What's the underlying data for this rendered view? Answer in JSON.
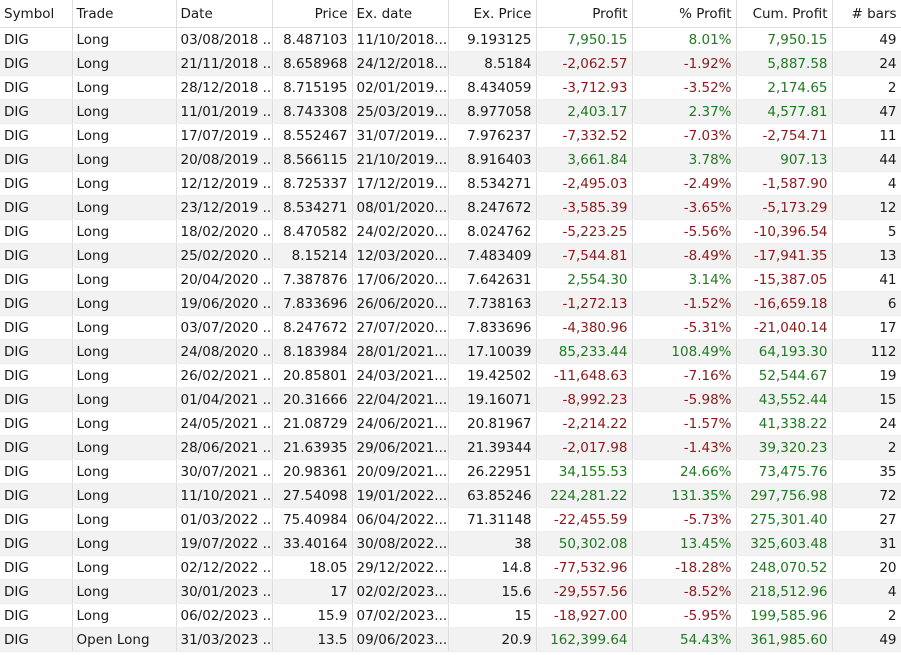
{
  "columns": [
    "Symbol",
    "Trade",
    "Date",
    "Price",
    "Ex. date",
    "Ex. Price",
    "Profit",
    "% Profit",
    "Cum. Profit",
    "# bars"
  ],
  "colors": {
    "positive": "#1f7a1f",
    "negative": "#8b1a1a",
    "stripe": "#f2f2f2"
  },
  "rows": [
    [
      "DIG",
      "Long",
      "03/08/2018 ...",
      "8.487103",
      "11/10/2018...",
      "9.193125",
      "7,950.15",
      "8.01%",
      "7,950.15",
      "49"
    ],
    [
      "DIG",
      "Long",
      "21/11/2018 ...",
      "8.658968",
      "24/12/2018...",
      "8.5184",
      "-2,062.57",
      "-1.92%",
      "5,887.58",
      "24"
    ],
    [
      "DIG",
      "Long",
      "28/12/2018 ...",
      "8.715195",
      "02/01/2019...",
      "8.434059",
      "-3,712.93",
      "-3.52%",
      "2,174.65",
      "2"
    ],
    [
      "DIG",
      "Long",
      "11/01/2019 ...",
      "8.743308",
      "25/03/2019...",
      "8.977058",
      "2,403.17",
      "2.37%",
      "4,577.81",
      "47"
    ],
    [
      "DIG",
      "Long",
      "17/07/2019 ...",
      "8.552467",
      "31/07/2019...",
      "7.976237",
      "-7,332.52",
      "-7.03%",
      "-2,754.71",
      "11"
    ],
    [
      "DIG",
      "Long",
      "20/08/2019 ...",
      "8.566115",
      "21/10/2019...",
      "8.916403",
      "3,661.84",
      "3.78%",
      "907.13",
      "44"
    ],
    [
      "DIG",
      "Long",
      "12/12/2019 ...",
      "8.725337",
      "17/12/2019...",
      "8.534271",
      "-2,495.03",
      "-2.49%",
      "-1,587.90",
      "4"
    ],
    [
      "DIG",
      "Long",
      "23/12/2019 ...",
      "8.534271",
      "08/01/2020...",
      "8.247672",
      "-3,585.39",
      "-3.65%",
      "-5,173.29",
      "12"
    ],
    [
      "DIG",
      "Long",
      "18/02/2020 ...",
      "8.470582",
      "24/02/2020...",
      "8.024762",
      "-5,223.25",
      "-5.56%",
      "-10,396.54",
      "5"
    ],
    [
      "DIG",
      "Long",
      "25/02/2020 ...",
      "8.15214",
      "12/03/2020...",
      "7.483409",
      "-7,544.81",
      "-8.49%",
      "-17,941.35",
      "13"
    ],
    [
      "DIG",
      "Long",
      "20/04/2020 ...",
      "7.387876",
      "17/06/2020...",
      "7.642631",
      "2,554.30",
      "3.14%",
      "-15,387.05",
      "41"
    ],
    [
      "DIG",
      "Long",
      "19/06/2020 ...",
      "7.833696",
      "26/06/2020...",
      "7.738163",
      "-1,272.13",
      "-1.52%",
      "-16,659.18",
      "6"
    ],
    [
      "DIG",
      "Long",
      "03/07/2020 ...",
      "8.247672",
      "27/07/2020...",
      "7.833696",
      "-4,380.96",
      "-5.31%",
      "-21,040.14",
      "17"
    ],
    [
      "DIG",
      "Long",
      "24/08/2020 ...",
      "8.183984",
      "28/01/2021...",
      "17.10039",
      "85,233.44",
      "108.49%",
      "64,193.30",
      "112"
    ],
    [
      "DIG",
      "Long",
      "26/02/2021 ...",
      "20.85801",
      "24/03/2021...",
      "19.42502",
      "-11,648.63",
      "-7.16%",
      "52,544.67",
      "19"
    ],
    [
      "DIG",
      "Long",
      "01/04/2021 ...",
      "20.31666",
      "22/04/2021...",
      "19.16071",
      "-8,992.23",
      "-5.98%",
      "43,552.44",
      "15"
    ],
    [
      "DIG",
      "Long",
      "24/05/2021 ...",
      "21.08729",
      "24/06/2021...",
      "20.81967",
      "-2,214.22",
      "-1.57%",
      "41,338.22",
      "24"
    ],
    [
      "DIG",
      "Long",
      "28/06/2021 ...",
      "21.63935",
      "29/06/2021...",
      "21.39344",
      "-2,017.98",
      "-1.43%",
      "39,320.23",
      "2"
    ],
    [
      "DIG",
      "Long",
      "30/07/2021 ...",
      "20.98361",
      "20/09/2021...",
      "26.22951",
      "34,155.53",
      "24.66%",
      "73,475.76",
      "35"
    ],
    [
      "DIG",
      "Long",
      "11/10/2021 ...",
      "27.54098",
      "19/01/2022...",
      "63.85246",
      "224,281.22",
      "131.35%",
      "297,756.98",
      "72"
    ],
    [
      "DIG",
      "Long",
      "01/03/2022 ...",
      "75.40984",
      "06/04/2022...",
      "71.31148",
      "-22,455.59",
      "-5.73%",
      "275,301.40",
      "27"
    ],
    [
      "DIG",
      "Long",
      "19/07/2022 ...",
      "33.40164",
      "30/08/2022...",
      "38",
      "50,302.08",
      "13.45%",
      "325,603.48",
      "31"
    ],
    [
      "DIG",
      "Long",
      "02/12/2022 ...",
      "18.05",
      "29/12/2022...",
      "14.8",
      "-77,532.96",
      "-18.28%",
      "248,070.52",
      "20"
    ],
    [
      "DIG",
      "Long",
      "30/01/2023 ...",
      "17",
      "02/02/2023...",
      "15.6",
      "-29,557.56",
      "-8.52%",
      "218,512.96",
      "4"
    ],
    [
      "DIG",
      "Long",
      "06/02/2023 ...",
      "15.9",
      "07/02/2023...",
      "15",
      "-18,927.00",
      "-5.95%",
      "199,585.96",
      "2"
    ],
    [
      "DIG",
      "Open Long",
      "31/03/2023 ...",
      "13.5",
      "09/06/2023...",
      "20.9",
      "162,399.64",
      "54.43%",
      "361,985.60",
      "49"
    ]
  ]
}
